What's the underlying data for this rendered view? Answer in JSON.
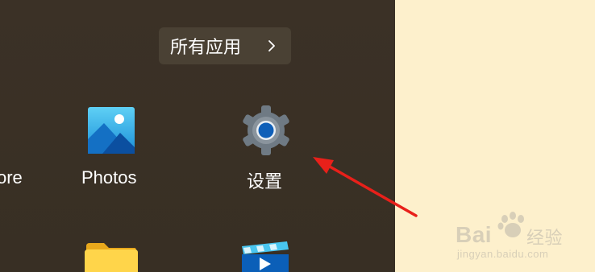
{
  "start_menu": {
    "all_apps_label": "所有应用",
    "apps": [
      {
        "label": "ore",
        "icon": "store-icon"
      },
      {
        "label": "Photos",
        "icon": "photos-icon"
      },
      {
        "label": "设置",
        "icon": "gear-icon"
      },
      {
        "label": "",
        "icon": "folder-icon"
      },
      {
        "label": "",
        "icon": "media-player-icon"
      }
    ]
  },
  "watermark": {
    "brand": "Bai",
    "brand2": "经验",
    "url": "jingyan.baidu.com"
  },
  "colors": {
    "panel_bg": "#3a3024",
    "page_bg": "#fdf0cc",
    "arrow": "#e8201a"
  }
}
